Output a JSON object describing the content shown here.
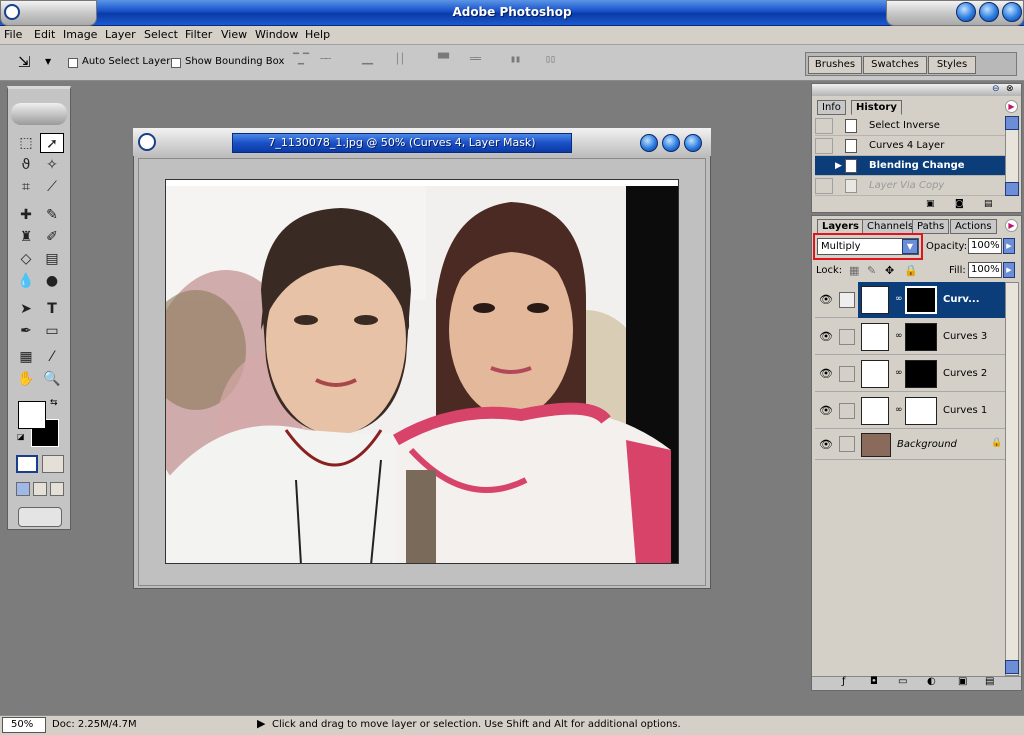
{
  "app": {
    "title": "Adobe Photoshop"
  },
  "menu": [
    "File",
    "Edit",
    "Image",
    "Layer",
    "Select",
    "Filter",
    "View",
    "Window",
    "Help"
  ],
  "options": {
    "auto_select_layer": "Auto Select Layer",
    "show_bounding_box": "Show Bounding Box"
  },
  "palette_well": {
    "tabs": [
      "Brushes",
      "Swatches",
      "Styles"
    ]
  },
  "document": {
    "title": "7_1130078_1.jpg @ 50% (Curves 4, Layer Mask)"
  },
  "history": {
    "tabs": [
      "Info",
      "History"
    ],
    "items": [
      "Select Inverse",
      "Curves 4 Layer",
      "Blending Change",
      "Layer Via Copy"
    ],
    "selected_index": 2
  },
  "layers": {
    "tabs": [
      "Layers",
      "Channels",
      "Paths",
      "Actions"
    ],
    "blend_mode": "Multiply",
    "opacity_label": "Opacity:",
    "opacity": "100%",
    "lock_label": "Lock:",
    "fill_label": "Fill:",
    "fill": "100%",
    "items": [
      {
        "name": "Curv..."
      },
      {
        "name": "Curves 3"
      },
      {
        "name": "Curves 2"
      },
      {
        "name": "Curves 1"
      },
      {
        "name": "Background"
      }
    ]
  },
  "status": {
    "zoom": "50%",
    "doc": "Doc: 2.25M/4.7M",
    "hint": "Click and drag to move layer or selection.  Use Shift and Alt for additional options."
  },
  "colors": {
    "accent_blue": "#0a3ba6",
    "selection_blue": "#0a3d7a",
    "highlight_red": "#e0141e"
  }
}
